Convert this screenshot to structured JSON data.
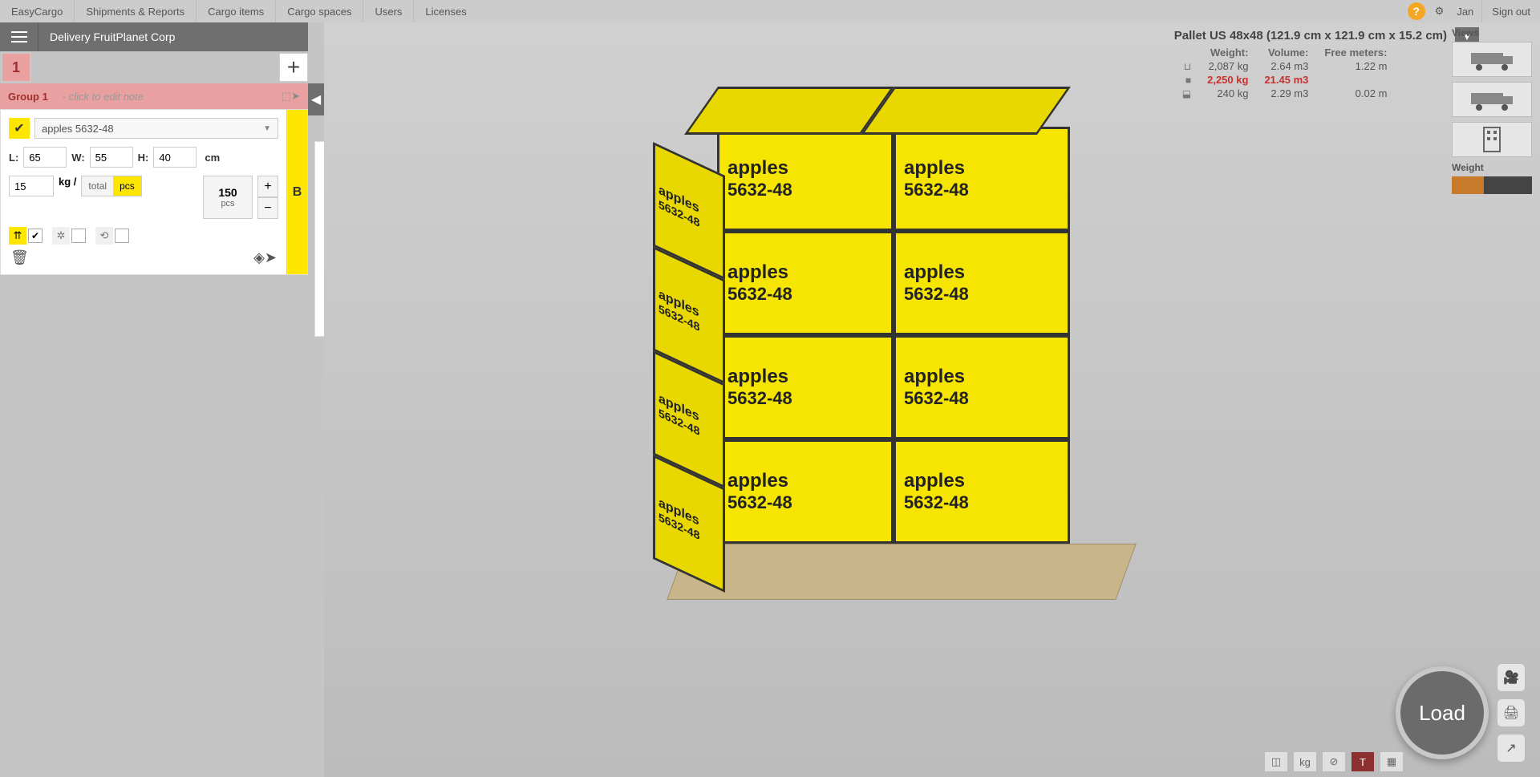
{
  "nav": {
    "brand": "EasyCargo",
    "items": [
      "Shipments & Reports",
      "Cargo items",
      "Cargo spaces",
      "Users",
      "Licenses"
    ],
    "user": "Jan",
    "signout": "Sign out"
  },
  "titlebar": {
    "title": "Delivery FruitPlanet Corp"
  },
  "tabs": {
    "active": "1"
  },
  "group": {
    "name": "Group 1",
    "note_placeholder": "- click to edit note"
  },
  "item": {
    "name": "apples 5632-48",
    "L_label": "L:",
    "L": "65",
    "W_label": "W:",
    "W": "55",
    "H_label": "H:",
    "H": "40",
    "dim_unit": "cm",
    "weight": "15",
    "weight_unit": "kg /",
    "seg_total": "total",
    "seg_pcs": "pcs",
    "qty": "150",
    "qty_label": "pcs",
    "strip": "B",
    "box_line1": "apples",
    "box_line2": "5632-48"
  },
  "info": {
    "title": "Pallet US 48x48 (121.9 cm x 121.9 cm x 15.2 cm)",
    "headers": {
      "weight": "Weight:",
      "volume": "Volume:",
      "freem": "Free meters:"
    },
    "rows": [
      {
        "icon": "⊔",
        "w": "2,087 kg",
        "v": "2.64 m3",
        "f": "1.22 m",
        "red": false
      },
      {
        "icon": "■",
        "w": "2,250 kg",
        "v": "21.45 m3",
        "f": "",
        "red": true
      },
      {
        "icon": "⬓",
        "w": "240 kg",
        "v": "2.29 m3",
        "f": "0.02 m",
        "red": false
      }
    ]
  },
  "views": {
    "label": "Views",
    "weight_label": "Weight"
  },
  "load_button": "Load"
}
